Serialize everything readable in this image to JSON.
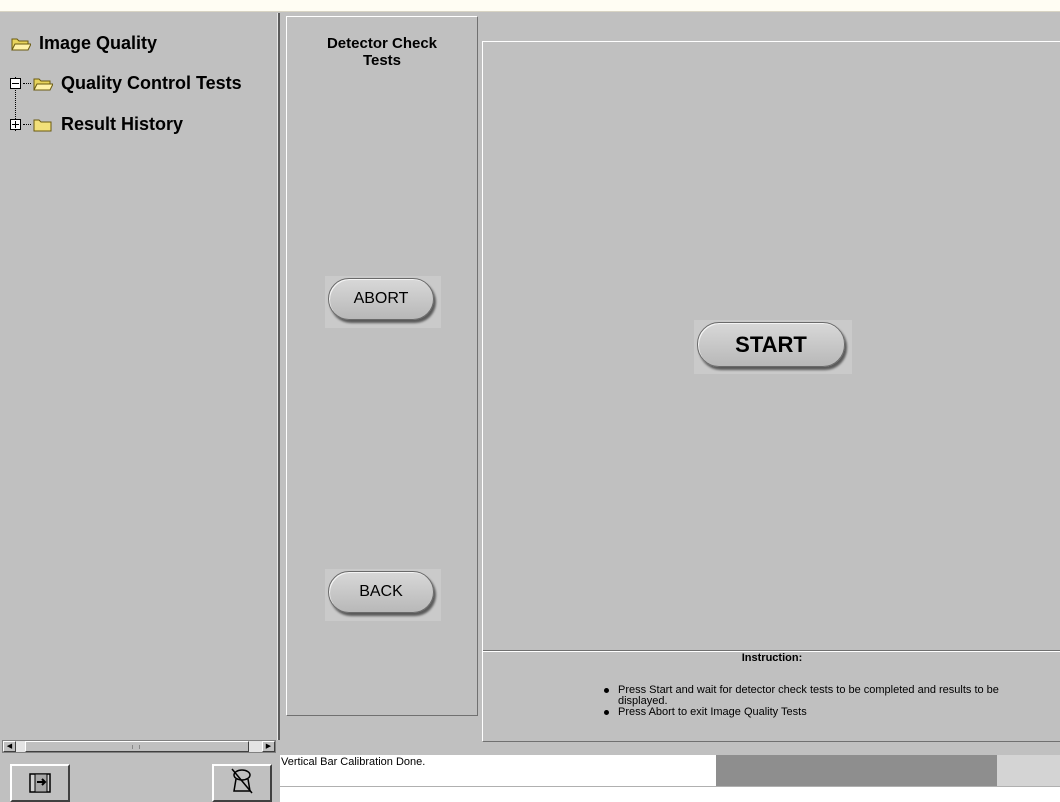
{
  "tree": {
    "items": [
      {
        "label": "Image Quality"
      },
      {
        "label": "Quality Control Tests"
      },
      {
        "label": "Result History"
      }
    ]
  },
  "middle_panel": {
    "title_line1": "Detector Check",
    "title_line2": "Tests",
    "abort_label": "ABORT",
    "back_label": "BACK"
  },
  "main": {
    "start_label": "START",
    "instruction_title": "Instruction:",
    "instructions": [
      "Press Start and wait for detector check tests to be completed and results to be displayed.",
      "Press Abort to exit Image Quality Tests"
    ]
  },
  "status": {
    "message": "Vertical Bar Calibration Done."
  },
  "icons": {
    "exit": "exit-door-icon",
    "detector": "detector-off-icon"
  },
  "colors": {
    "background": "#c0c0c0",
    "folder": "#f2e07a"
  }
}
